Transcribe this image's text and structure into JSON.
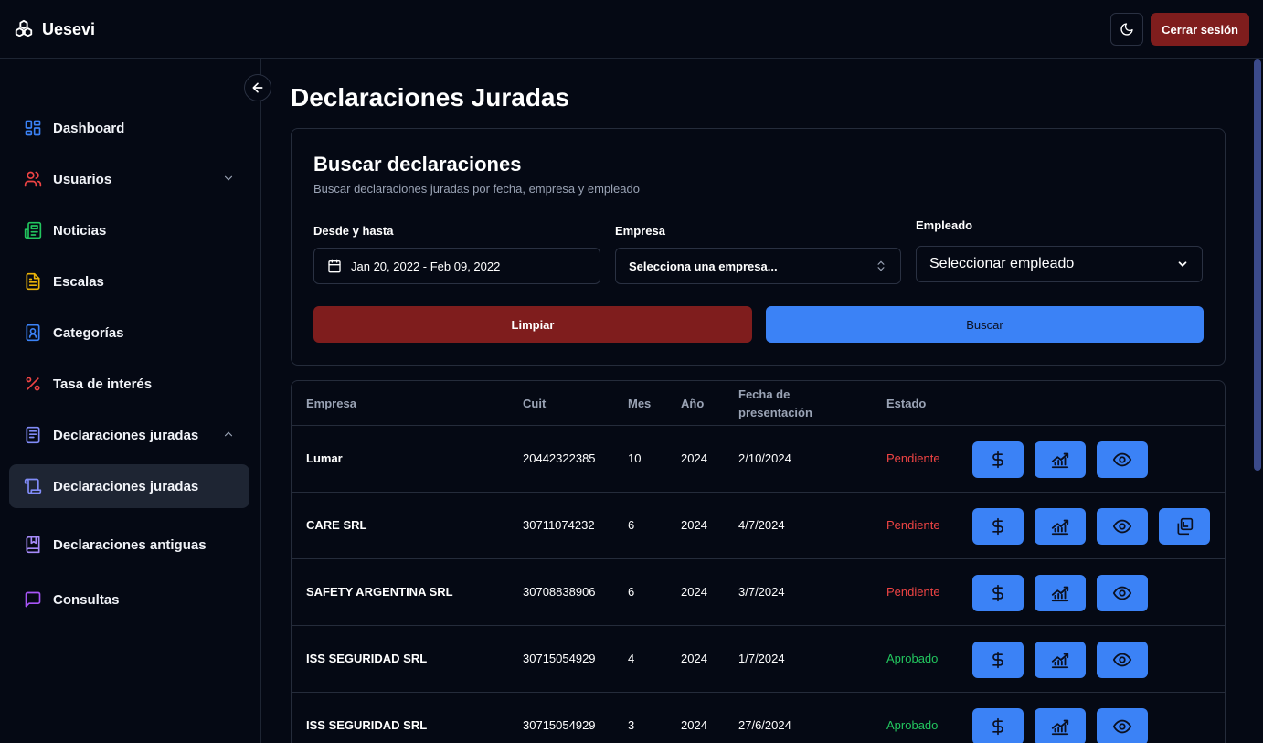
{
  "app": {
    "name": "Uesevi"
  },
  "header": {
    "logout_label": "Cerrar sesión"
  },
  "sidebar": {
    "items": [
      {
        "label": "Dashboard",
        "color": "#3b82f6"
      },
      {
        "label": "Usuarios",
        "color": "#ef4444"
      },
      {
        "label": "Noticias",
        "color": "#22c55e"
      },
      {
        "label": "Escalas",
        "color": "#eab308"
      },
      {
        "label": "Categorías",
        "color": "#3b82f6"
      },
      {
        "label": "Tasa de interés",
        "color": "#ef4444"
      },
      {
        "label": "Declaraciones juradas",
        "color": "#818cf8"
      },
      {
        "label": "Declaraciones juradas",
        "color": "#818cf8"
      },
      {
        "label": "Declaraciones antiguas",
        "color": "#a78bfa"
      },
      {
        "label": "Consultas",
        "color": "#a855f7"
      }
    ]
  },
  "page": {
    "title": "Declaraciones Juradas"
  },
  "search": {
    "title": "Buscar declaraciones",
    "subtitle": "Buscar declaraciones juradas por fecha, empresa y empleado",
    "date_label": "Desde y hasta",
    "date_value": "Jan 20, 2022 - Feb 09, 2022",
    "company_label": "Empresa",
    "company_value": "Selecciona una empresa...",
    "employee_label": "Empleado",
    "employee_value": "Seleccionar empleado",
    "clear_label": "Limpiar",
    "search_label": "Buscar"
  },
  "table": {
    "headers": [
      "Empresa",
      "Cuit",
      "Mes",
      "Año",
      "Fecha de presentación",
      "Estado"
    ],
    "rows": [
      {
        "empresa": "Lumar",
        "cuit": "20442322385",
        "mes": "10",
        "anio": "2024",
        "fecha": "2/10/2024",
        "estado": "Pendiente"
      },
      {
        "empresa": "CARE SRL",
        "cuit": "30711074232",
        "mes": "6",
        "anio": "2024",
        "fecha": "4/7/2024",
        "estado": "Pendiente"
      },
      {
        "empresa": "SAFETY ARGENTINA SRL",
        "cuit": "30708838906",
        "mes": "6",
        "anio": "2024",
        "fecha": "3/7/2024",
        "estado": "Pendiente"
      },
      {
        "empresa": "ISS SEGURIDAD SRL",
        "cuit": "30715054929",
        "mes": "4",
        "anio": "2024",
        "fecha": "1/7/2024",
        "estado": "Aprobado"
      },
      {
        "empresa": "ISS SEGURIDAD SRL",
        "cuit": "30715054929",
        "mes": "3",
        "anio": "2024",
        "fecha": "27/6/2024",
        "estado": "Aprobado"
      }
    ]
  },
  "colors": {
    "pending": "#ef4444",
    "approved": "#22c55e",
    "primary": "#3b82f6",
    "danger": "#7f1d1d"
  }
}
